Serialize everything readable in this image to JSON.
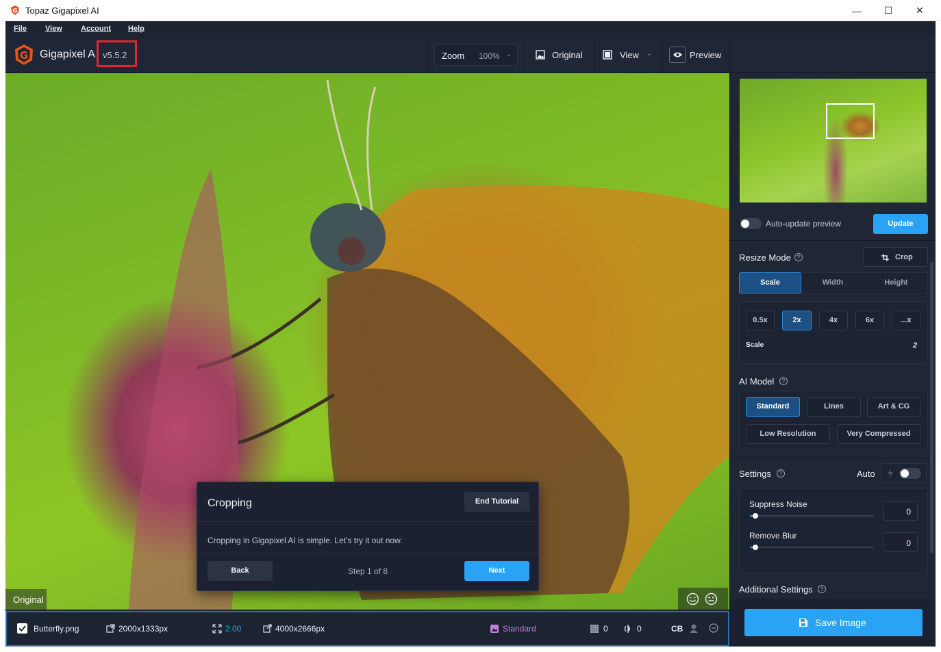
{
  "window": {
    "title": "Topaz Gigapixel AI",
    "minimize": "—",
    "maximize": "☐",
    "close": "✕"
  },
  "menu": {
    "file": "File",
    "view": "View",
    "account": "Account",
    "help": "Help"
  },
  "toolbar": {
    "brand": "Gigapixel A",
    "version": "v5.5.2",
    "zoom_label": "Zoom",
    "zoom_value": "100%",
    "original_label": "Original",
    "view_label": "View",
    "preview_label": "Preview"
  },
  "canvas": {
    "original_label": "Original"
  },
  "tutorial": {
    "title": "Cropping",
    "end_label": "End Tutorial",
    "body": "Cropping in Gigapixel AI is simple. Let's try it out now.",
    "back_label": "Back",
    "step": "Step 1 of 8",
    "next_label": "Next"
  },
  "status": {
    "filename": "Butterfly.png",
    "input_size": "2000x1333px",
    "scale": "2.00",
    "output_size": "4000x2666px",
    "model": "Standard",
    "noise": "0",
    "blur": "0",
    "cb": "CB"
  },
  "panel": {
    "auto_update_label": "Auto-update preview",
    "update_label": "Update",
    "resize_mode_label": "Resize Mode",
    "crop_label": "Crop",
    "mode_tabs": [
      "Scale",
      "Width",
      "Height"
    ],
    "scale_options": [
      "0.5x",
      "2x",
      "4x",
      "6x",
      "...x"
    ],
    "scale_label": "Scale",
    "scale_value": "2",
    "ai_model_label": "AI Model",
    "models_row1": [
      "Standard",
      "Lines",
      "Art & CG"
    ],
    "models_row2": [
      "Low Resolution",
      "Very Compressed"
    ],
    "settings_label": "Settings",
    "auto_label": "Auto",
    "suppress_noise_label": "Suppress Noise",
    "suppress_noise_value": "0",
    "remove_blur_label": "Remove Blur",
    "remove_blur_value": "0",
    "additional_settings_label": "Additional Settings",
    "save_label": "Save Image"
  },
  "colors": {
    "accent": "#2aa3f5",
    "selected": "#1c4f82",
    "model_status": "#c77dde",
    "highlight_box": "#e8232e"
  }
}
